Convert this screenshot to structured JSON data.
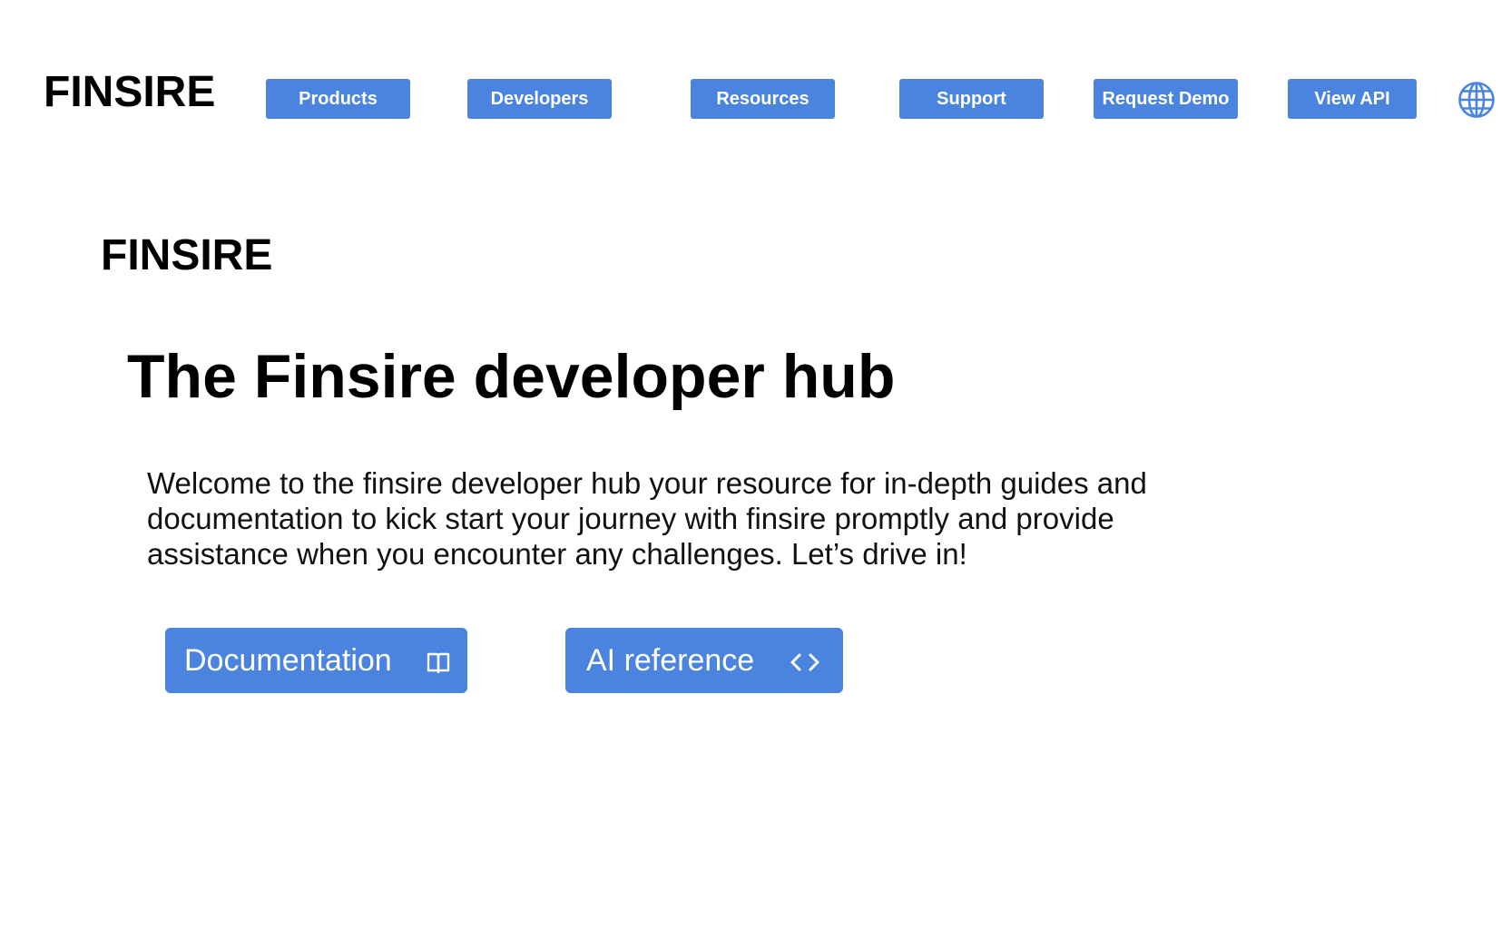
{
  "header": {
    "logo": "FINSIRE",
    "nav": [
      {
        "label": "Products"
      },
      {
        "label": "Developers"
      },
      {
        "label": "Resources"
      },
      {
        "label": "Support"
      },
      {
        "label": "Request Demo"
      },
      {
        "label": "View API"
      }
    ],
    "language_icon": "globe-icon"
  },
  "hero": {
    "logo": "FINSIRE",
    "title": "The Finsire developer hub",
    "description": "Welcome to the finsire developer hub your resource for in-depth guides and documentation to kick start your journey with finsire promptly and provide assistance when you encounter any challenges. Let’s drive in!",
    "buttons": [
      {
        "label": "Documentation",
        "icon": "book-icon"
      },
      {
        "label": "AI reference",
        "icon": "code-icon"
      }
    ]
  },
  "colors": {
    "accent": "#4A84DE",
    "text": "#000000",
    "background": "#FFFFFF"
  }
}
